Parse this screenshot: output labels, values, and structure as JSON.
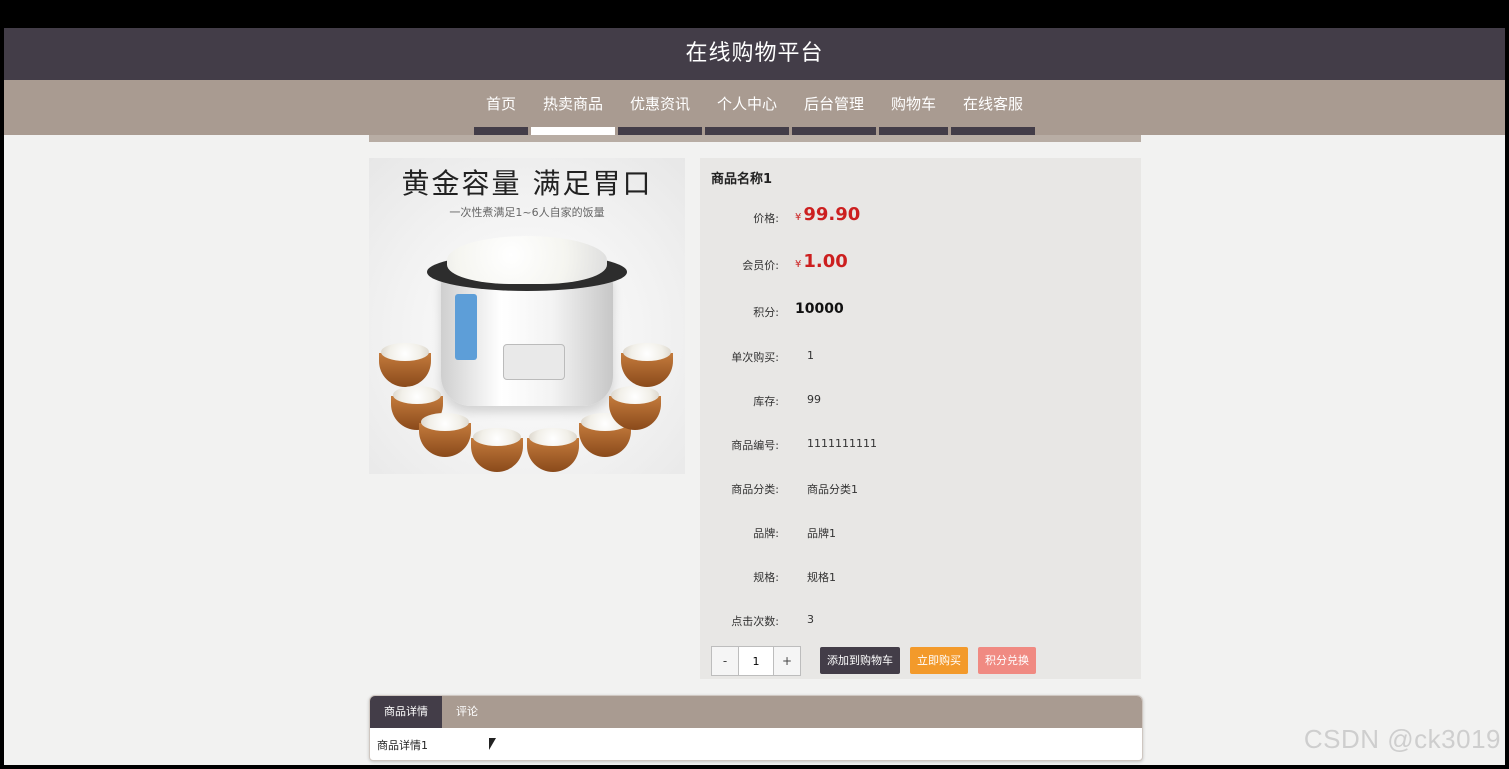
{
  "header": {
    "title": "在线购物平台"
  },
  "nav": {
    "items": [
      {
        "label": "首页",
        "active": false
      },
      {
        "label": "热卖商品",
        "active": true
      },
      {
        "label": "优惠资讯",
        "active": false
      },
      {
        "label": "个人中心",
        "active": false
      },
      {
        "label": "后台管理",
        "active": false
      },
      {
        "label": "购物车",
        "active": false
      },
      {
        "label": "在线客服",
        "active": false
      }
    ]
  },
  "image": {
    "banner_title": "黄金容量 满足胃口",
    "banner_subtitle": "一次性煮满足1~6人自家的饭量"
  },
  "product": {
    "name": "商品名称1",
    "currency": "¥",
    "price_label": "价格:",
    "price": "99.90",
    "member_price_label": "会员价:",
    "member_price": "1.00",
    "points_label": "积分:",
    "points": "10000",
    "details": [
      {
        "label": "单次购买:",
        "value": "1"
      },
      {
        "label": "库存:",
        "value": "99"
      },
      {
        "label": "商品编号:",
        "value": "1111111111"
      },
      {
        "label": "商品分类:",
        "value": "商品分类1"
      },
      {
        "label": "品牌:",
        "value": "品牌1"
      },
      {
        "label": "规格:",
        "value": "规格1"
      },
      {
        "label": "点击次数:",
        "value": "3"
      }
    ]
  },
  "purchase": {
    "minus": "-",
    "quantity": "1",
    "plus": "+",
    "add_to_cart": "添加到购物车",
    "buy_now": "立即购买",
    "redeem_points": "积分兑换"
  },
  "tabs": {
    "items": [
      {
        "label": "商品详情",
        "active": true
      },
      {
        "label": "评论",
        "active": false
      }
    ],
    "content": "商品详情1"
  },
  "watermark": "CSDN @ck3019",
  "colors": {
    "header_bg": "#433d48",
    "nav_bg": "#a99b91",
    "price_red": "#cc1f1f",
    "buy_orange": "#f39a2b",
    "points_pink": "#f08a82"
  }
}
